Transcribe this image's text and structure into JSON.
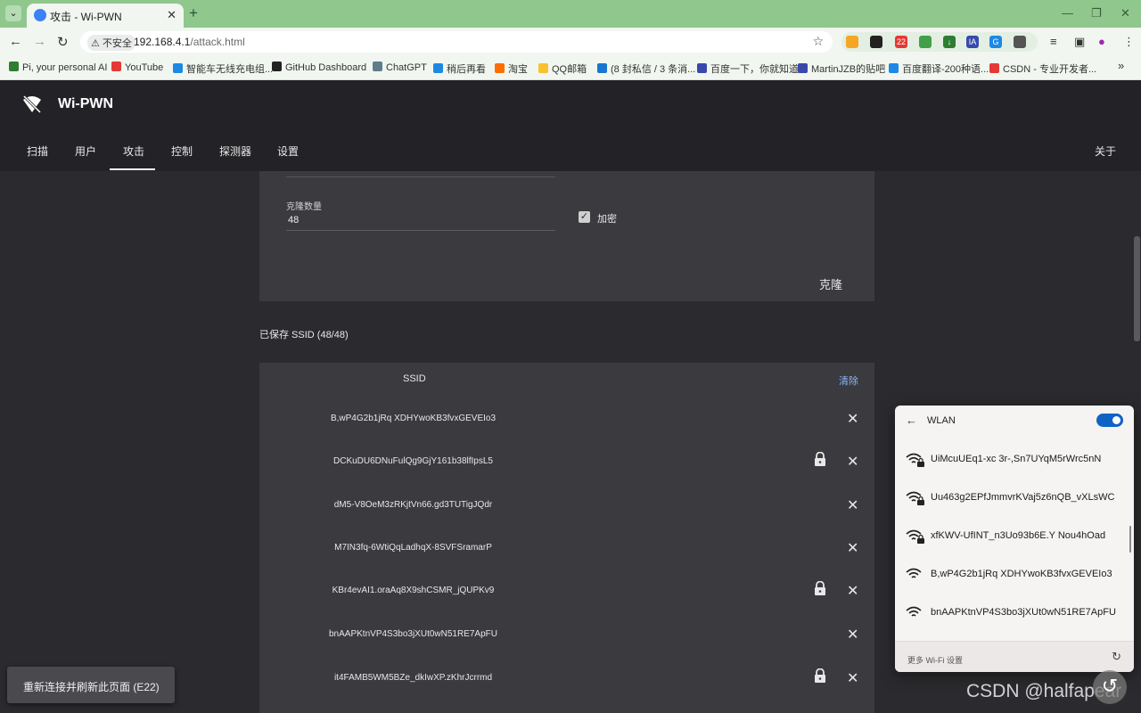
{
  "browser": {
    "tab_title": "攻击 - Wi-PWN",
    "insecure_label": "不安全",
    "url_host": "192.168.4.1",
    "url_path": "/attack.html",
    "ext_badge": "22"
  },
  "bookmarks": [
    {
      "label": "Pi, your personal AI",
      "color": "#2e7d32"
    },
    {
      "label": "YouTube",
      "color": "#e53935"
    },
    {
      "label": "智能车无线充电组...",
      "color": "#1e88e5"
    },
    {
      "label": "GitHub Dashboard",
      "color": "#222222"
    },
    {
      "label": "ChatGPT",
      "color": "#607d8b"
    },
    {
      "label": "稍后再看",
      "color": "#1e88e5"
    },
    {
      "label": "淘宝",
      "color": "#ff6d00"
    },
    {
      "label": "QQ邮箱",
      "color": "#fbc02d"
    },
    {
      "label": "(8 封私信 / 3 条消...",
      "color": "#1976d2"
    },
    {
      "label": "百度一下，你就知道",
      "color": "#3949ab"
    },
    {
      "label": "MartinJZB的贴吧",
      "color": "#3949ab"
    },
    {
      "label": "百度翻译-200种语...",
      "color": "#1e88e5"
    },
    {
      "label": "CSDN - 专业开发者...",
      "color": "#e53935"
    }
  ],
  "app": {
    "title": "Wi-PWN",
    "nav": [
      "扫描",
      "用户",
      "攻击",
      "控制",
      "探测器",
      "设置"
    ],
    "about": "关于"
  },
  "clone_card": {
    "count_label": "克隆数量",
    "count_value": "48",
    "encrypt_label": "加密",
    "encrypt_checked": true,
    "clone_button": "克隆"
  },
  "saved": {
    "title": "已保存 SSID (48/48)",
    "column_header": "SSID",
    "clear_label": "清除",
    "rows": [
      {
        "ssid": "B,wP4G2b1jRq XDHYwoKB3fvxGEVEIo3",
        "locked": false
      },
      {
        "ssid": "DCKuDU6DNuFulQg9GjY161b38lfIpsL5",
        "locked": true
      },
      {
        "ssid": "dM5-V8OeM3zRKjtVn66.gd3TUTigJQdr",
        "locked": false
      },
      {
        "ssid": "M7IN3fq-6WtiQqLadhqX-8SVFSramarP",
        "locked": false
      },
      {
        "ssid": "KBr4evAI1.oraAq8X9shCSMR_jQUPKv9",
        "locked": true
      },
      {
        "ssid": "bnAAPKtnVP4S3bo3jXUt0wN51RE7ApFU",
        "locked": false
      },
      {
        "ssid": "it4FAMB5WM5BZe_dkIwXP.zKhrJcrrmd",
        "locked": true
      }
    ]
  },
  "toast": {
    "text": "重新连接并刷新此页面 (E22)"
  },
  "wlan": {
    "title": "WLAN",
    "enabled": true,
    "networks": [
      {
        "name": "UiMcuUEq1-xc 3r-,Sn7UYqM5rWrc5nN",
        "secured": true
      },
      {
        "name": "Uu463g2EPfJmmvrKVaj5z6nQB_vXLsWC",
        "secured": true
      },
      {
        "name": "xfKWV-UfINT_n3Uo93b6E.Y Nou4hOad",
        "secured": true
      },
      {
        "name": "B,wP4G2b1jRq XDHYwoKB3fvxGEVEIo3",
        "secured": false
      },
      {
        "name": "bnAAPKtnVP4S3bo3jXUt0wN51RE7ApFU",
        "secured": false
      }
    ],
    "more_settings": "更多 Wi-Fi 设置"
  },
  "watermark": "CSDN @halfapear"
}
